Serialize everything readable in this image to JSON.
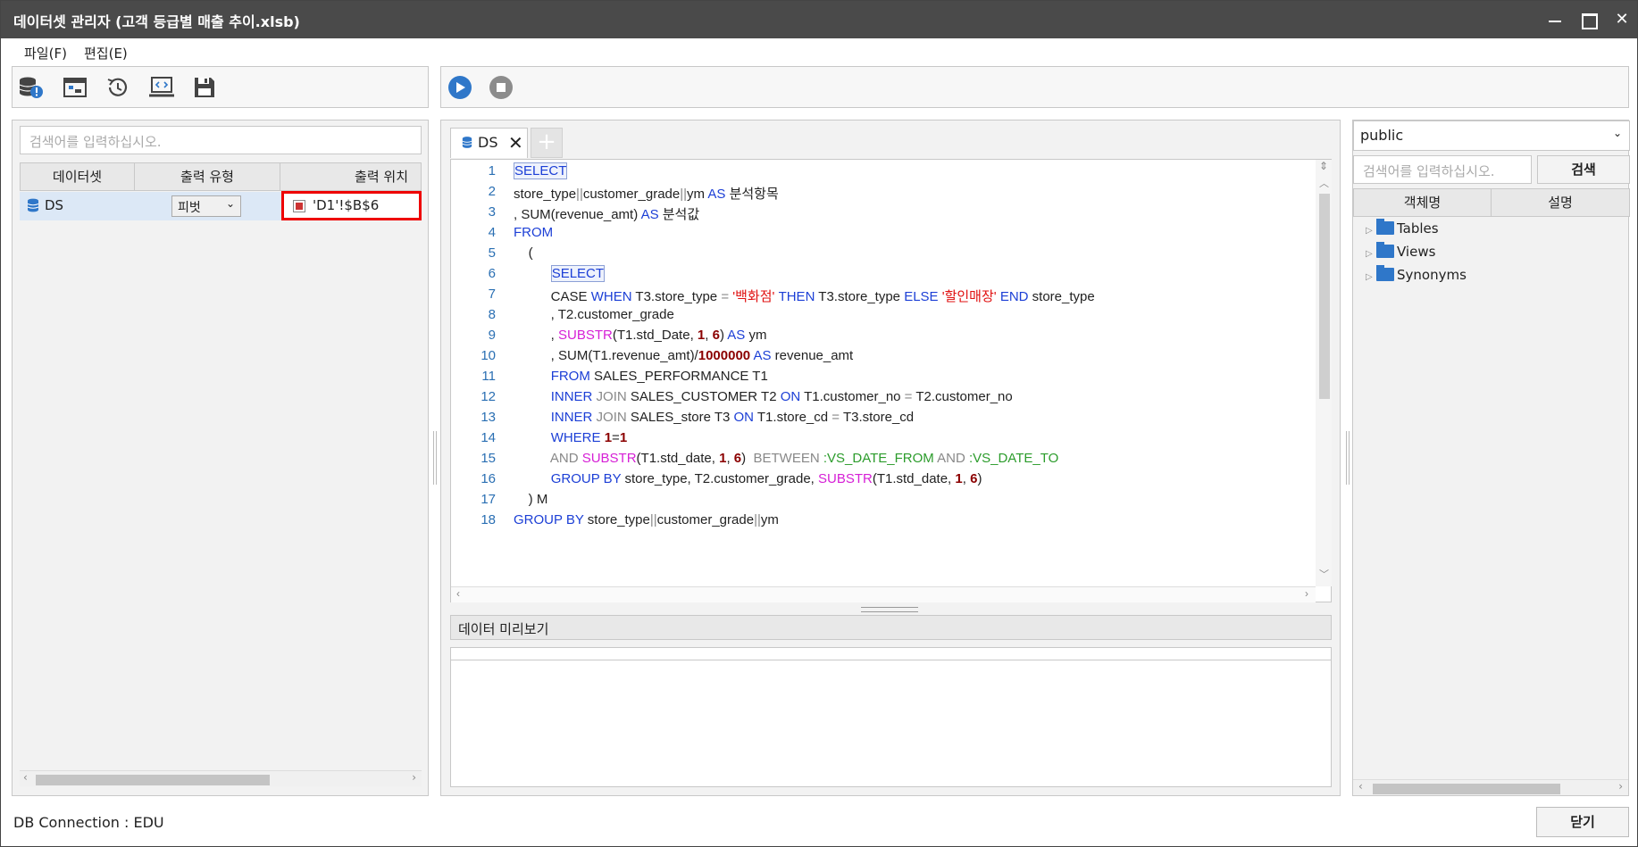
{
  "window": {
    "title": "데이터셋 관리자 (고객 등급별 매출 추이.xlsb)"
  },
  "menu": {
    "file": "파일(F)",
    "edit": "편집(E)"
  },
  "toolbar_left_icons": [
    "database-warning-icon",
    "window-icon",
    "history-icon",
    "monitor-code-icon",
    "save-icon"
  ],
  "toolbar_right_icons": [
    "play-icon",
    "stop-icon"
  ],
  "dataset_panel": {
    "search_placeholder": "검색어를 입력하십시오.",
    "columns": [
      "데이터셋",
      "출력 유형",
      "출력 위치"
    ],
    "rows": [
      {
        "name": "DS",
        "output_type": "피벗",
        "output_position": "'D1'!$B$6"
      }
    ]
  },
  "editor": {
    "tab_label": "DS",
    "tab_add": "+",
    "line_numbers": [
      "1",
      "2",
      "3",
      "4",
      "5",
      "6",
      "7",
      "8",
      "9",
      "10",
      "11",
      "12",
      "13",
      "14",
      "15",
      "16",
      "17",
      "18"
    ]
  },
  "preview": {
    "header": "데이터 미리보기"
  },
  "object_panel": {
    "schema": "public",
    "search_placeholder": "검색어를 입력하십시오.",
    "search_button": "검색",
    "columns": [
      "객체명",
      "설명"
    ],
    "tree": [
      "Tables",
      "Views",
      "Synonyms"
    ]
  },
  "status": {
    "connection": "DB Connection : EDU"
  },
  "close_button": "닫기"
}
